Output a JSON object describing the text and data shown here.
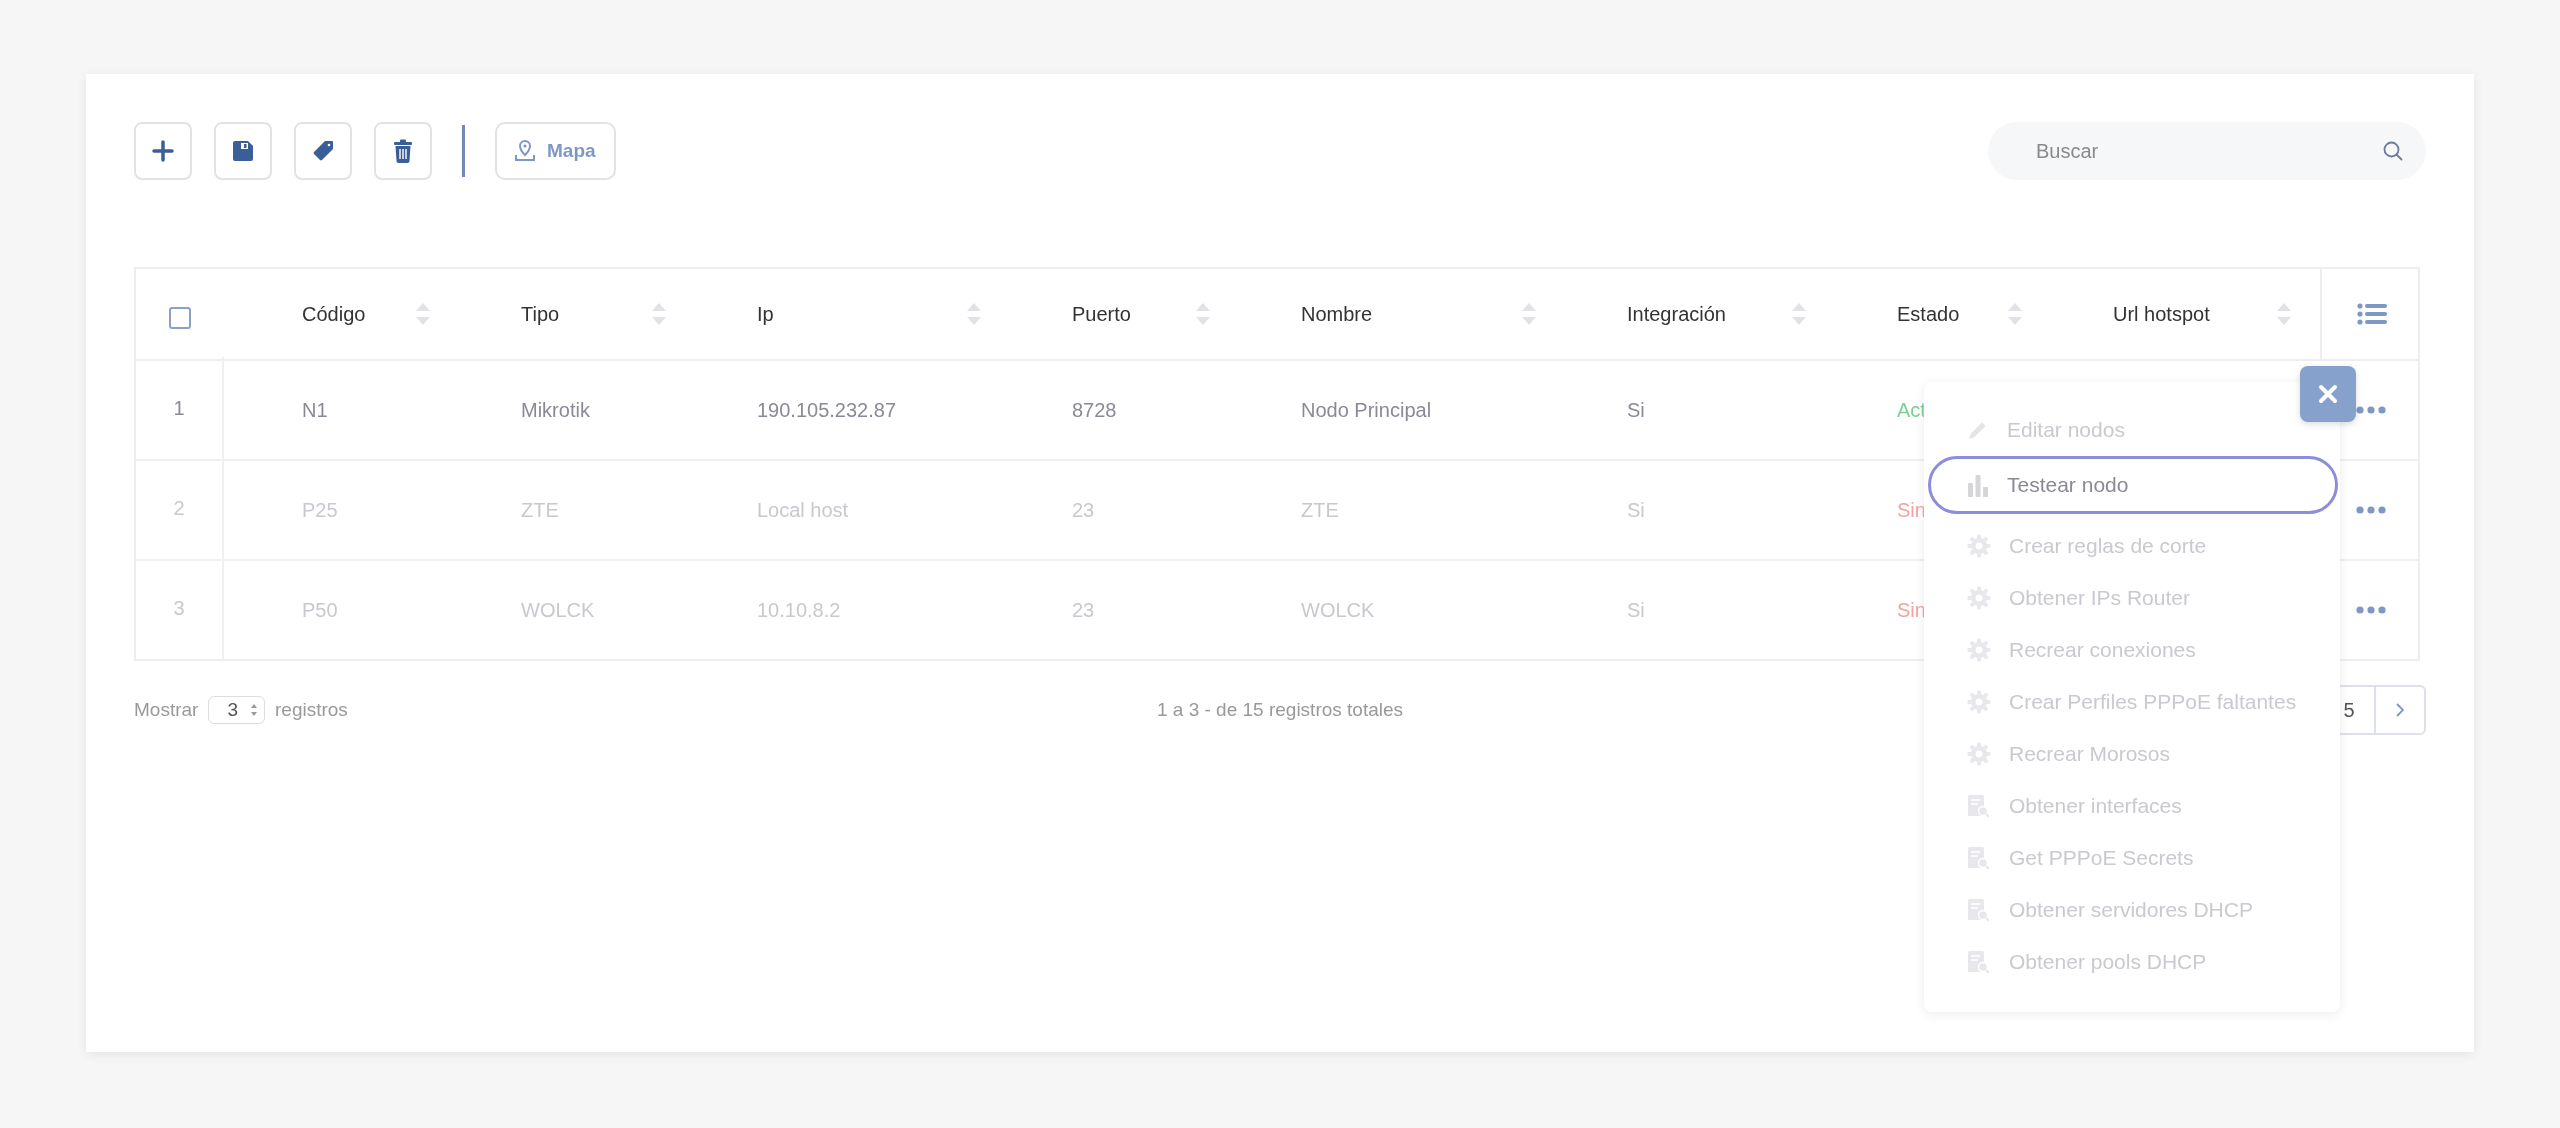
{
  "toolbar": {
    "buttons": [
      {
        "kind": "add"
      },
      {
        "kind": "save"
      },
      {
        "kind": "tag"
      },
      {
        "kind": "delete"
      }
    ],
    "map_button": {
      "label": "Mapa"
    }
  },
  "search": {
    "placeholder": "Buscar"
  },
  "table": {
    "select_all": {
      "checked": false
    },
    "columns": [
      "Código",
      "Tipo",
      "Ip",
      "Puerto",
      "Nombre",
      "Integración",
      "Estado",
      "Url hotspot"
    ],
    "rows": [
      {
        "number": "1",
        "cells": [
          "N1",
          "Mikrotik",
          "190.105.232.87",
          "8728",
          "Nodo Principal",
          "Si"
        ],
        "status": {
          "text": "Act",
          "color": "#7dcf94"
        },
        "disabled": false
      },
      {
        "number": "2",
        "cells": [
          "P25",
          "ZTE",
          "Local host",
          "23",
          "ZTE",
          "Si"
        ],
        "status": {
          "text": "Sin",
          "color": "#f0a4a4"
        },
        "disabled": true
      },
      {
        "number": "3",
        "cells": [
          "P50",
          "WOLCK",
          "10.10.8.2",
          "23",
          "WOLCK",
          "Si"
        ],
        "status": {
          "text": "Sin",
          "color": "#f0a4a4"
        },
        "disabled": true
      }
    ]
  },
  "footer": {
    "show_label": "Mostrar",
    "page_size": "3",
    "records_label": "registros",
    "summary": "1 a 3 - de 15 registros totales",
    "pages": [
      {
        "label": "5",
        "selected": false
      }
    ]
  },
  "menu": {
    "items": [
      {
        "label": "Editar nodos",
        "kind": "pencil",
        "selected": false
      },
      {
        "label": "Testear nodo",
        "kind": "chart",
        "selected": true
      },
      {
        "label": "Crear reglas de corte",
        "kind": "gear",
        "selected": false
      },
      {
        "label": "Obtener IPs Router",
        "kind": "gear",
        "selected": false
      },
      {
        "label": "Recrear conexiones",
        "kind": "gear",
        "selected": false
      },
      {
        "label": "Crear Perfiles PPPoE faltantes",
        "kind": "gear",
        "selected": false
      },
      {
        "label": "Recrear Morosos",
        "kind": "gear",
        "selected": false
      },
      {
        "label": "Obtener interfaces",
        "kind": "document",
        "selected": false
      },
      {
        "label": "Get PPPoE Secrets",
        "kind": "document",
        "selected": false
      },
      {
        "label": "Obtener servidores DHCP",
        "kind": "document",
        "selected": false
      },
      {
        "label": "Obtener pools DHCP",
        "kind": "document",
        "selected": false
      }
    ]
  }
}
